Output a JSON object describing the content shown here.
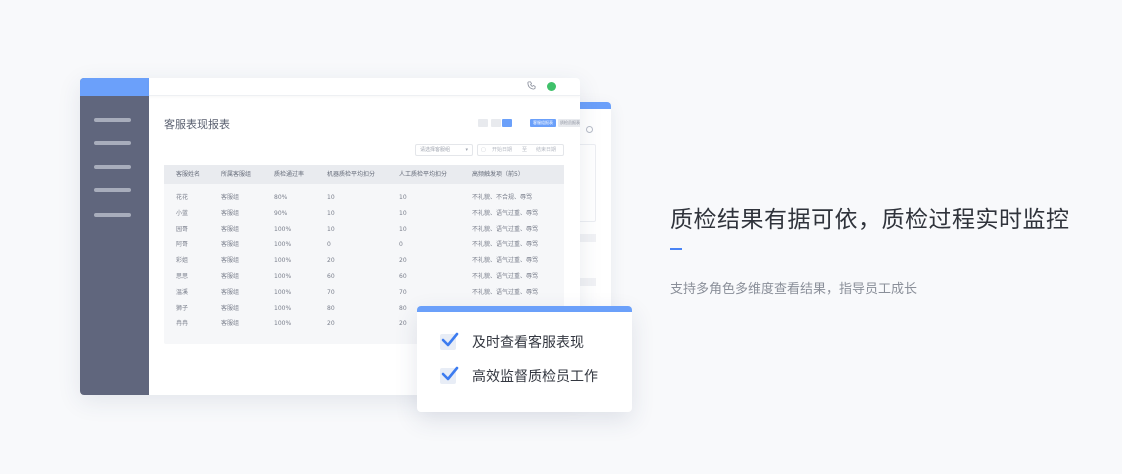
{
  "window": {
    "report_title": "客服表现报表",
    "tag_active": "客服组报表",
    "tag_other": "质检员报表",
    "filter": {
      "select_placeholder": "请选择客服组",
      "date_start": "开始日期",
      "date_sep": "至",
      "date_end": "结束日期"
    },
    "table": {
      "columns": [
        "客服姓名",
        "所属客服组",
        "质检通过率",
        "机器质检平均扣分",
        "人工质检平均扣分",
        "高频触发项（前5）"
      ],
      "rows": [
        [
          "花花",
          "客服组",
          "80%",
          "10",
          "10",
          "不礼貌、不合规、辱骂"
        ],
        [
          "小蓝",
          "客服组",
          "90%",
          "10",
          "10",
          "不礼貌、语气过重、辱骂"
        ],
        [
          "园哥",
          "客服组",
          "100%",
          "10",
          "10",
          "不礼貌、语气过重、辱骂"
        ],
        [
          "阿哥",
          "客服组",
          "100%",
          "0",
          "0",
          "不礼貌、语气过重、辱骂"
        ],
        [
          "彩姐",
          "客服组",
          "100%",
          "20",
          "20",
          "不礼貌、语气过重、辱骂"
        ],
        [
          "思思",
          "客服组",
          "100%",
          "60",
          "60",
          "不礼貌、语气过重、辱骂"
        ],
        [
          "温溪",
          "客服组",
          "100%",
          "70",
          "70",
          "不礼貌、语气过重、辱骂"
        ],
        [
          "狮子",
          "客服组",
          "100%",
          "80",
          "80",
          ""
        ],
        [
          "冉冉",
          "客服组",
          "100%",
          "20",
          "20",
          ""
        ]
      ]
    }
  },
  "checklist": {
    "items": [
      "及时查看客服表现",
      "高效监督质检员工作"
    ]
  },
  "hero": {
    "headline": "质检结果有据可依，质检过程实时监控",
    "subline": "支持多角色多维度查看结果，指导员工成长"
  },
  "colors": {
    "accent": "#6ba0fa",
    "sidebar": "#60667d",
    "check": "#3d7cf0"
  },
  "icons": [
    "phone-icon",
    "chat-icon",
    "check-icon",
    "caret-down-icon",
    "calendar-icon"
  ]
}
